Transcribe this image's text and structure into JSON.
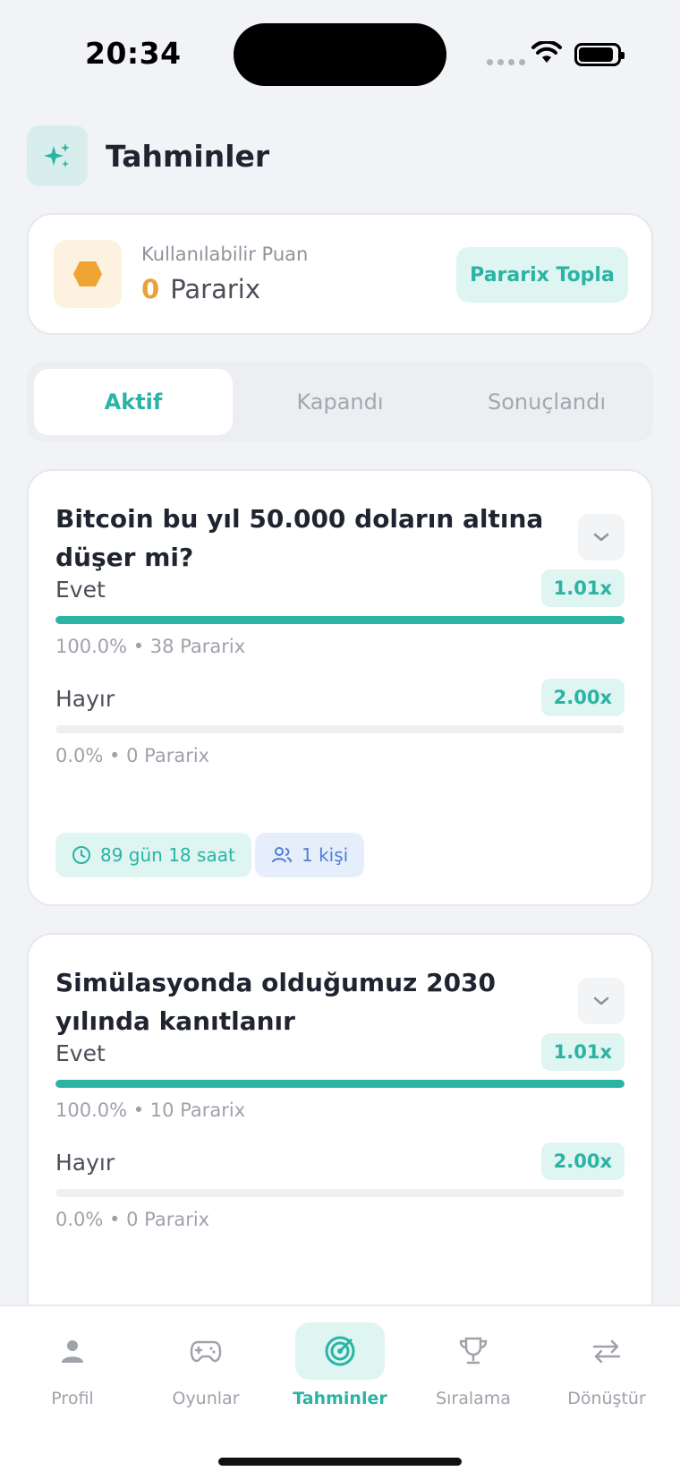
{
  "status_bar": {
    "time": "20:34"
  },
  "header": {
    "title": "Tahminler",
    "icon": "sparkles-icon"
  },
  "points": {
    "label": "Kullanılabilir Puan",
    "value": "0",
    "unit": "Pararix",
    "icon": "hexagon-coin-icon",
    "collect_button": "Pararix Topla"
  },
  "tabs": [
    {
      "label": "Aktif",
      "active": true
    },
    {
      "label": "Kapandı",
      "active": false
    },
    {
      "label": "Sonuçlandı",
      "active": false
    }
  ],
  "predictions": [
    {
      "question": "Bitcoin bu yıl 50.000 doların altına düşer mi?",
      "options": [
        {
          "label": "Evet",
          "multiplier": "1.01x",
          "stats": "100.0% • 38 Pararix",
          "share": 1.0
        },
        {
          "label": "Hayır",
          "multiplier": "2.00x",
          "stats": "0.0% • 0 Pararix",
          "share": 0.0
        }
      ],
      "time_left": "89 gün 18 saat",
      "participants": "1 kişi"
    },
    {
      "question": "Simülasyonda olduğumuz 2030 yılında kanıtlanır",
      "options": [
        {
          "label": "Evet",
          "multiplier": "1.01x",
          "stats": "100.0% • 10 Pararix",
          "share": 1.0
        },
        {
          "label": "Hayır",
          "multiplier": "2.00x",
          "stats": "0.0% • 0 Pararix",
          "share": 0.0
        }
      ]
    }
  ],
  "nav": [
    {
      "label": "Profil",
      "icon": "person-icon",
      "active": false
    },
    {
      "label": "Oyunlar",
      "icon": "gamepad-icon",
      "active": false
    },
    {
      "label": "Tahminler",
      "icon": "target-icon",
      "active": true
    },
    {
      "label": "Sıralama",
      "icon": "trophy-icon",
      "active": false
    },
    {
      "label": "Dönüştür",
      "icon": "swap-arrows-icon",
      "active": false
    }
  ],
  "colors": {
    "accent": "#2bb3a3",
    "coin": "#e9a23b",
    "people": "#4d7fd6"
  }
}
